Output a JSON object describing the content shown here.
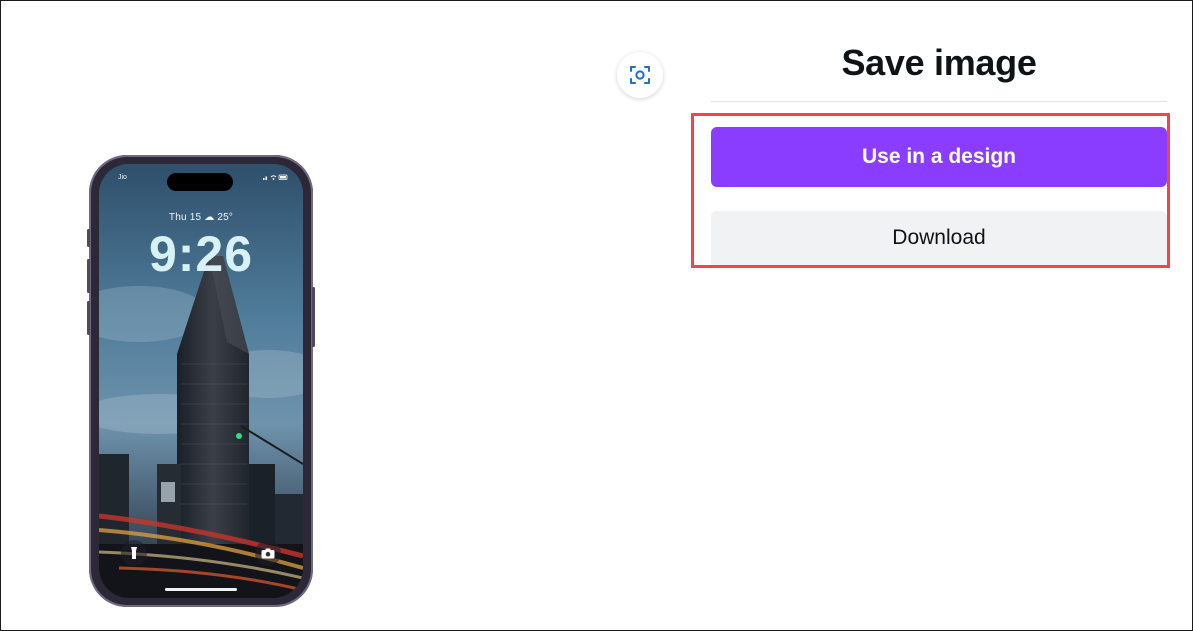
{
  "panel": {
    "title": "Save image",
    "primary_button": "Use in a design",
    "secondary_button": "Download"
  },
  "preview": {
    "carrier": "Jio",
    "date_weather": "Thu 15 ☁ 25°",
    "time": "9:26"
  },
  "icons": {
    "scan": "focus-scan-icon",
    "flashlight": "flashlight-icon",
    "camera": "camera-icon"
  },
  "colors": {
    "primary": "#8b3dff",
    "secondary_bg": "#f1f2f4",
    "highlight": "#f2444a",
    "scan_icon": "#1d6fc9"
  }
}
